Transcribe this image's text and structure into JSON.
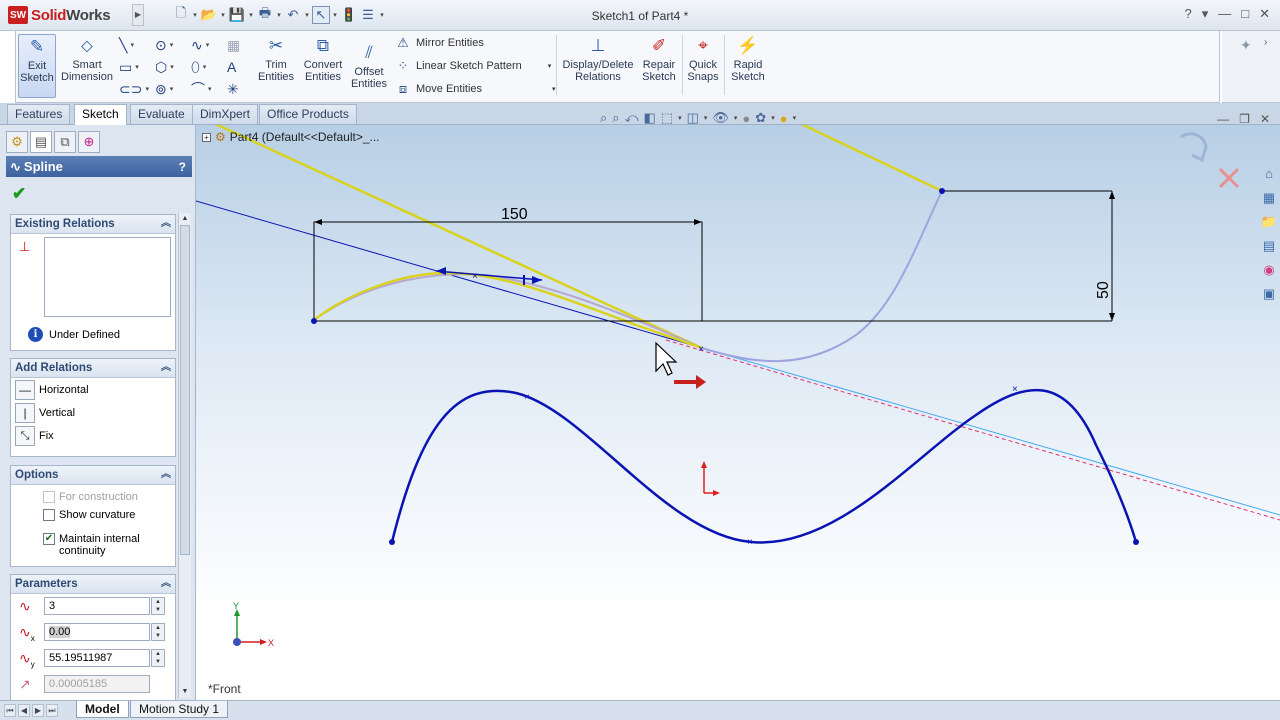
{
  "app": {
    "logo_brand": "Solid",
    "logo_rest": "Works",
    "document_title": "Sketch1 of Part4 *",
    "help_glyph": "?",
    "window_controls": [
      "▾",
      "—",
      "□",
      "✕"
    ]
  },
  "quick_access": [
    "new-icon",
    "open-icon",
    "save-icon",
    "print-icon",
    "undo-icon",
    "select-icon",
    "rebuild-icon",
    "options-icon"
  ],
  "ribbon": {
    "exit_sketch": "Exit Sketch",
    "smart_dimension": "Smart Dimension",
    "trim_entities": "Trim Entities",
    "convert_entities": "Convert Entities",
    "offset_entities": "Offset Entities",
    "mirror_entities": "Mirror Entities",
    "linear_sketch_pattern": "Linear Sketch Pattern",
    "move_entities": "Move Entities",
    "display_delete_relations": "Display/Delete Relations",
    "repair_sketch": "Repair Sketch",
    "quick_snaps": "Quick Snaps",
    "rapid_sketch": "Rapid Sketch"
  },
  "tabs": [
    "Features",
    "Sketch",
    "Evaluate",
    "DimXpert",
    "Office Products"
  ],
  "active_tab": "Sketch",
  "tree": {
    "part_label": "Part4  (Default<<Default>_..."
  },
  "property_manager": {
    "title": "Spline",
    "help": "?",
    "existing_relations": {
      "header": "Existing Relations",
      "status": "Under Defined"
    },
    "add_relations": {
      "header": "Add Relations",
      "items": [
        "Horizontal",
        "Vertical",
        "Fix"
      ]
    },
    "options": {
      "header": "Options",
      "for_construction": "For construction",
      "for_construction_checked": false,
      "show_curvature": "Show curvature",
      "show_curvature_checked": false,
      "maintain_continuity": "Maintain internal continuity",
      "maintain_continuity_checked": true
    },
    "parameters": {
      "header": "Parameters",
      "point_number": "3",
      "x_coordinate": "0.00",
      "y_coordinate": "55.19511987",
      "tangent_weight": "0.00005185"
    }
  },
  "graphics": {
    "dimension_horizontal": "150",
    "dimension_vertical": "50",
    "triad_y": "Y",
    "triad_x": "X",
    "view_name": "*Front"
  },
  "bottom_tabs": [
    "Model",
    "Motion Study 1"
  ],
  "active_bottom_tab": "Model",
  "colors": {
    "sketch_blue": "#0a14b4",
    "yellow_tangent": "#d9d21e",
    "preview_spline": "#9ea4e0",
    "red_accent": "#c8201e"
  }
}
